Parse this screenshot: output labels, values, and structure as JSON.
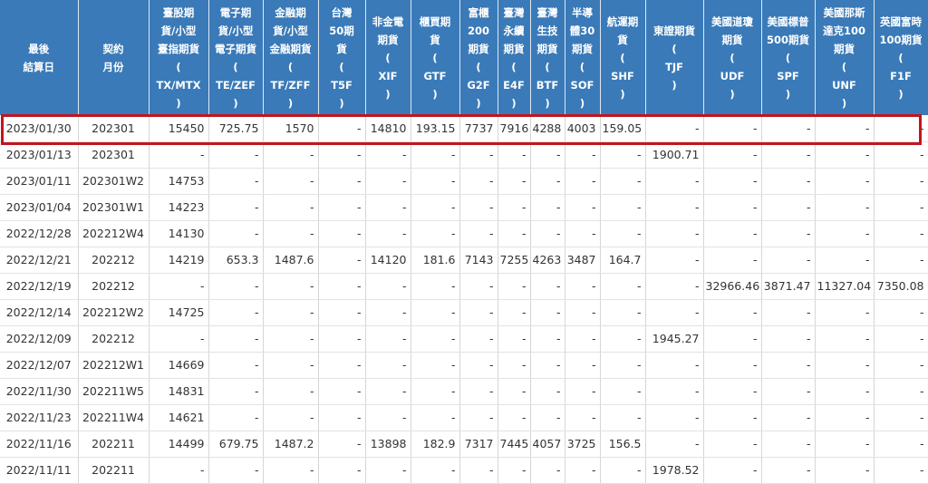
{
  "colors": {
    "header_bg": "#3a7ab8",
    "header_text": "#ffffff",
    "highlight": "#c0161e",
    "text": "#333333"
  },
  "headers": [
    [
      "最後",
      "結算日"
    ],
    [
      "契約",
      "月份"
    ],
    [
      "臺股期",
      "貨/小型",
      "臺指期貨",
      "(",
      "TX/MTX",
      ")"
    ],
    [
      "電子期",
      "貨/小型",
      "電子期貨",
      "(",
      "TE/ZEF",
      ")"
    ],
    [
      "金融期",
      "貨/小型",
      "金融期貨",
      "(",
      "TF/ZFF",
      ")"
    ],
    [
      "台灣",
      "50期",
      "貨",
      "(",
      "T5F",
      ")"
    ],
    [
      "非金電",
      "期貨",
      "(",
      "XIF",
      ")"
    ],
    [
      "櫃買期",
      "貨",
      "(",
      "GTF",
      ")"
    ],
    [
      "富櫃",
      "200",
      "期貨",
      "(",
      "G2F",
      ")"
    ],
    [
      "臺灣",
      "永續",
      "期貨",
      "(",
      "E4F",
      ")"
    ],
    [
      "臺灣",
      "生技",
      "期貨",
      "(",
      "BTF",
      ")"
    ],
    [
      "半導",
      "體30",
      "期貨",
      "(",
      "SOF",
      ")"
    ],
    [
      "航運期",
      "貨",
      "(",
      "SHF",
      ")"
    ],
    [
      "東證期貨",
      "(",
      "TJF",
      ")"
    ],
    [
      "美國道瓊",
      "期貨",
      "(",
      "UDF",
      ")"
    ],
    [
      "美國標普",
      "500期貨",
      "(",
      "SPF",
      ")"
    ],
    [
      "美國那斯",
      "達克100",
      "期貨",
      "(",
      "UNF",
      ")"
    ],
    [
      "英國富時",
      "100期貨",
      "(",
      "F1F",
      ")"
    ]
  ],
  "rows": [
    [
      "2023/01/30",
      "202301",
      "15450",
      "725.75",
      "1570",
      "-",
      "14810",
      "193.15",
      "7737",
      "7916",
      "4288",
      "4003",
      "159.05",
      "-",
      "-",
      "-",
      "-",
      "-"
    ],
    [
      "2023/01/13",
      "202301",
      "-",
      "-",
      "-",
      "-",
      "-",
      "-",
      "-",
      "-",
      "-",
      "-",
      "-",
      "1900.71",
      "-",
      "-",
      "-",
      "-"
    ],
    [
      "2023/01/11",
      "202301W2",
      "14753",
      "-",
      "-",
      "-",
      "-",
      "-",
      "-",
      "-",
      "-",
      "-",
      "-",
      "-",
      "-",
      "-",
      "-",
      "-"
    ],
    [
      "2023/01/04",
      "202301W1",
      "14223",
      "-",
      "-",
      "-",
      "-",
      "-",
      "-",
      "-",
      "-",
      "-",
      "-",
      "-",
      "-",
      "-",
      "-",
      "-"
    ],
    [
      "2022/12/28",
      "202212W4",
      "14130",
      "-",
      "-",
      "-",
      "-",
      "-",
      "-",
      "-",
      "-",
      "-",
      "-",
      "-",
      "-",
      "-",
      "-",
      "-"
    ],
    [
      "2022/12/21",
      "202212",
      "14219",
      "653.3",
      "1487.6",
      "-",
      "14120",
      "181.6",
      "7143",
      "7255",
      "4263",
      "3487",
      "164.7",
      "-",
      "-",
      "-",
      "-",
      "-"
    ],
    [
      "2022/12/19",
      "202212",
      "-",
      "-",
      "-",
      "-",
      "-",
      "-",
      "-",
      "-",
      "-",
      "-",
      "-",
      "-",
      "32966.46",
      "3871.47",
      "11327.04",
      "7350.08"
    ],
    [
      "2022/12/14",
      "202212W2",
      "14725",
      "-",
      "-",
      "-",
      "-",
      "-",
      "-",
      "-",
      "-",
      "-",
      "-",
      "-",
      "-",
      "-",
      "-",
      "-"
    ],
    [
      "2022/12/09",
      "202212",
      "-",
      "-",
      "-",
      "-",
      "-",
      "-",
      "-",
      "-",
      "-",
      "-",
      "-",
      "1945.27",
      "-",
      "-",
      "-",
      "-"
    ],
    [
      "2022/12/07",
      "202212W1",
      "14669",
      "-",
      "-",
      "-",
      "-",
      "-",
      "-",
      "-",
      "-",
      "-",
      "-",
      "-",
      "-",
      "-",
      "-",
      "-"
    ],
    [
      "2022/11/30",
      "202211W5",
      "14831",
      "-",
      "-",
      "-",
      "-",
      "-",
      "-",
      "-",
      "-",
      "-",
      "-",
      "-",
      "-",
      "-",
      "-",
      "-"
    ],
    [
      "2022/11/23",
      "202211W4",
      "14621",
      "-",
      "-",
      "-",
      "-",
      "-",
      "-",
      "-",
      "-",
      "-",
      "-",
      "-",
      "-",
      "-",
      "-",
      "-"
    ],
    [
      "2022/11/16",
      "202211",
      "14499",
      "679.75",
      "1487.2",
      "-",
      "13898",
      "182.9",
      "7317",
      "7445",
      "4057",
      "3725",
      "156.5",
      "-",
      "-",
      "-",
      "-",
      "-"
    ],
    [
      "2022/11/11",
      "202211",
      "-",
      "-",
      "-",
      "-",
      "-",
      "-",
      "-",
      "-",
      "-",
      "-",
      "-",
      "1978.52",
      "-",
      "-",
      "-",
      "-"
    ]
  ]
}
